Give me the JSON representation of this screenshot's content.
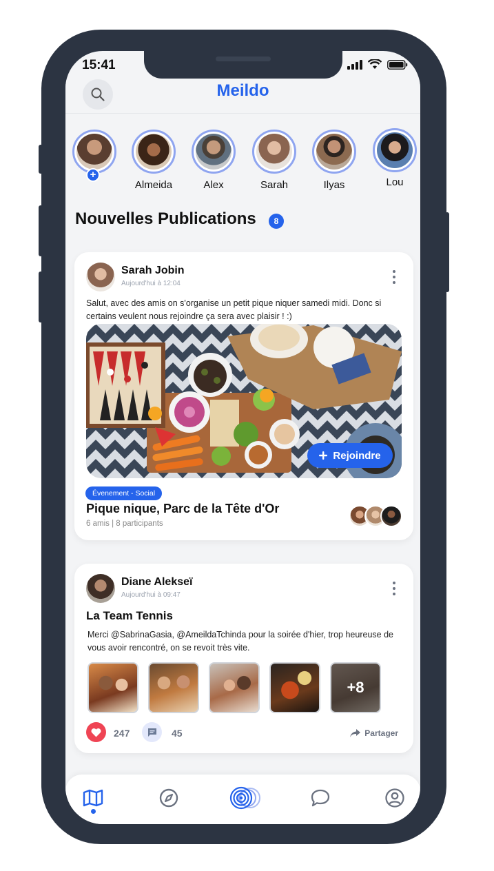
{
  "status": {
    "time": "15:41"
  },
  "header": {
    "title": "Meildo"
  },
  "stories": [
    {
      "name": "",
      "avatar_color": "#8b6a55"
    },
    {
      "name": "Almeida",
      "avatar_color": "#6b4630"
    },
    {
      "name": "Alex",
      "avatar_color": "#8a7a6c"
    },
    {
      "name": "Sarah",
      "avatar_color": "#c9a58f"
    },
    {
      "name": "Ilyas",
      "avatar_color": "#5c4a40"
    },
    {
      "name": "Lou",
      "avatar_color": "#6a7fa8"
    }
  ],
  "feed": {
    "title": "Nouvelles Publications",
    "count": "8"
  },
  "post1": {
    "author": "Sarah Jobin",
    "time": "Aujourd'hui à 12:04",
    "text": "Salut, avec des amis on s'organise un petit pique niquer samedi midi. Donc si certains veulent nous rejoindre ça sera avec plaisir !   :)",
    "join_label": "Rejoindre",
    "tag": "Évenement - Social",
    "event_title": "Pique nique, Parc de la Tête d'Or",
    "event_meta": "6 amis | 8 participants"
  },
  "post2": {
    "author": "Diane Alekseï",
    "time": "Aujourd'hui à 09:47",
    "title": "La Team Tennis",
    "text": "Merci @SabrinaGasia, @AmeildaTchinda pour la soirée d'hier, trop heureuse de vous avoir rencontré, on se revoit très vite.",
    "more_photos": "+8",
    "likes": "247",
    "comments": "45",
    "share_label": "Partager"
  },
  "colors": {
    "accent": "#2563eb",
    "like": "#ef4454",
    "frame": "#2c3442"
  },
  "nav": {
    "items": [
      "map-icon",
      "compass-icon",
      "radar-icon",
      "chat-icon",
      "profile-icon"
    ],
    "active": "map-icon"
  }
}
